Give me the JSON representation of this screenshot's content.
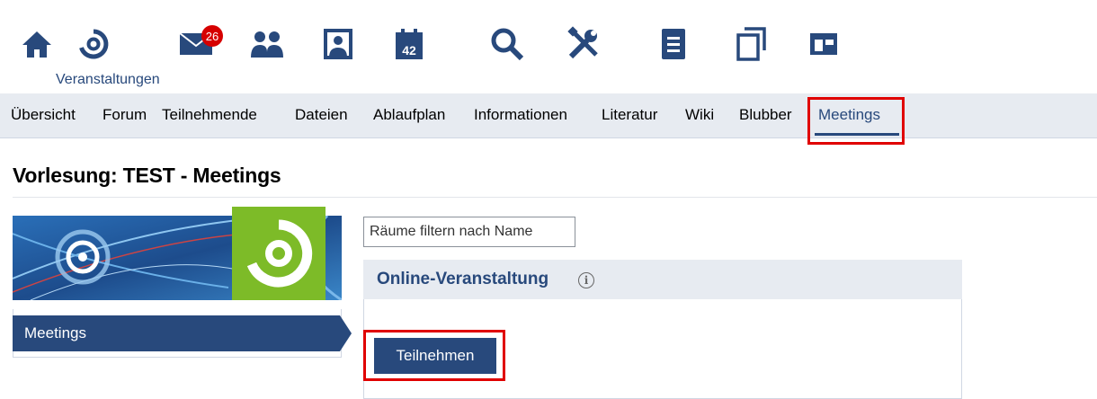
{
  "navbar": {
    "items": [
      {
        "icon": "home-icon"
      },
      {
        "icon": "courses-icon",
        "label": "Veranstaltungen",
        "active": true
      },
      {
        "icon": "mail-icon",
        "badge": "26"
      },
      {
        "icon": "community-icon"
      },
      {
        "icon": "profile-icon"
      },
      {
        "icon": "calendar-icon",
        "day": "42"
      },
      {
        "icon": "search-icon"
      },
      {
        "icon": "tools-icon"
      },
      {
        "icon": "document-icon"
      },
      {
        "icon": "files-icon"
      },
      {
        "icon": "admin-icon"
      }
    ],
    "active_label": "Veranstaltungen",
    "mail_badge": "26",
    "calendar_day": "42"
  },
  "tabs": {
    "items": [
      "Übersicht",
      "Forum",
      "Teilnehmende",
      "Dateien",
      "Ablaufplan",
      "Informationen",
      "Literatur",
      "Wiki",
      "Blubber",
      "Meetings"
    ],
    "active": "Meetings"
  },
  "page": {
    "title": "Vorlesung: TEST - Meetings"
  },
  "sidebar": {
    "item_label": "Meetings"
  },
  "main": {
    "filter_placeholder": "Räume filtern nach Name",
    "room": {
      "title": "Online-Veranstaltung",
      "info_symbol": "i",
      "join_label": "Teilnehmen"
    }
  },
  "colors": {
    "brand": "#28497c",
    "tab_bg": "#e7ebf1",
    "highlight": "#e00000",
    "badge": "#d60000",
    "logo_green": "#7dbb28"
  }
}
